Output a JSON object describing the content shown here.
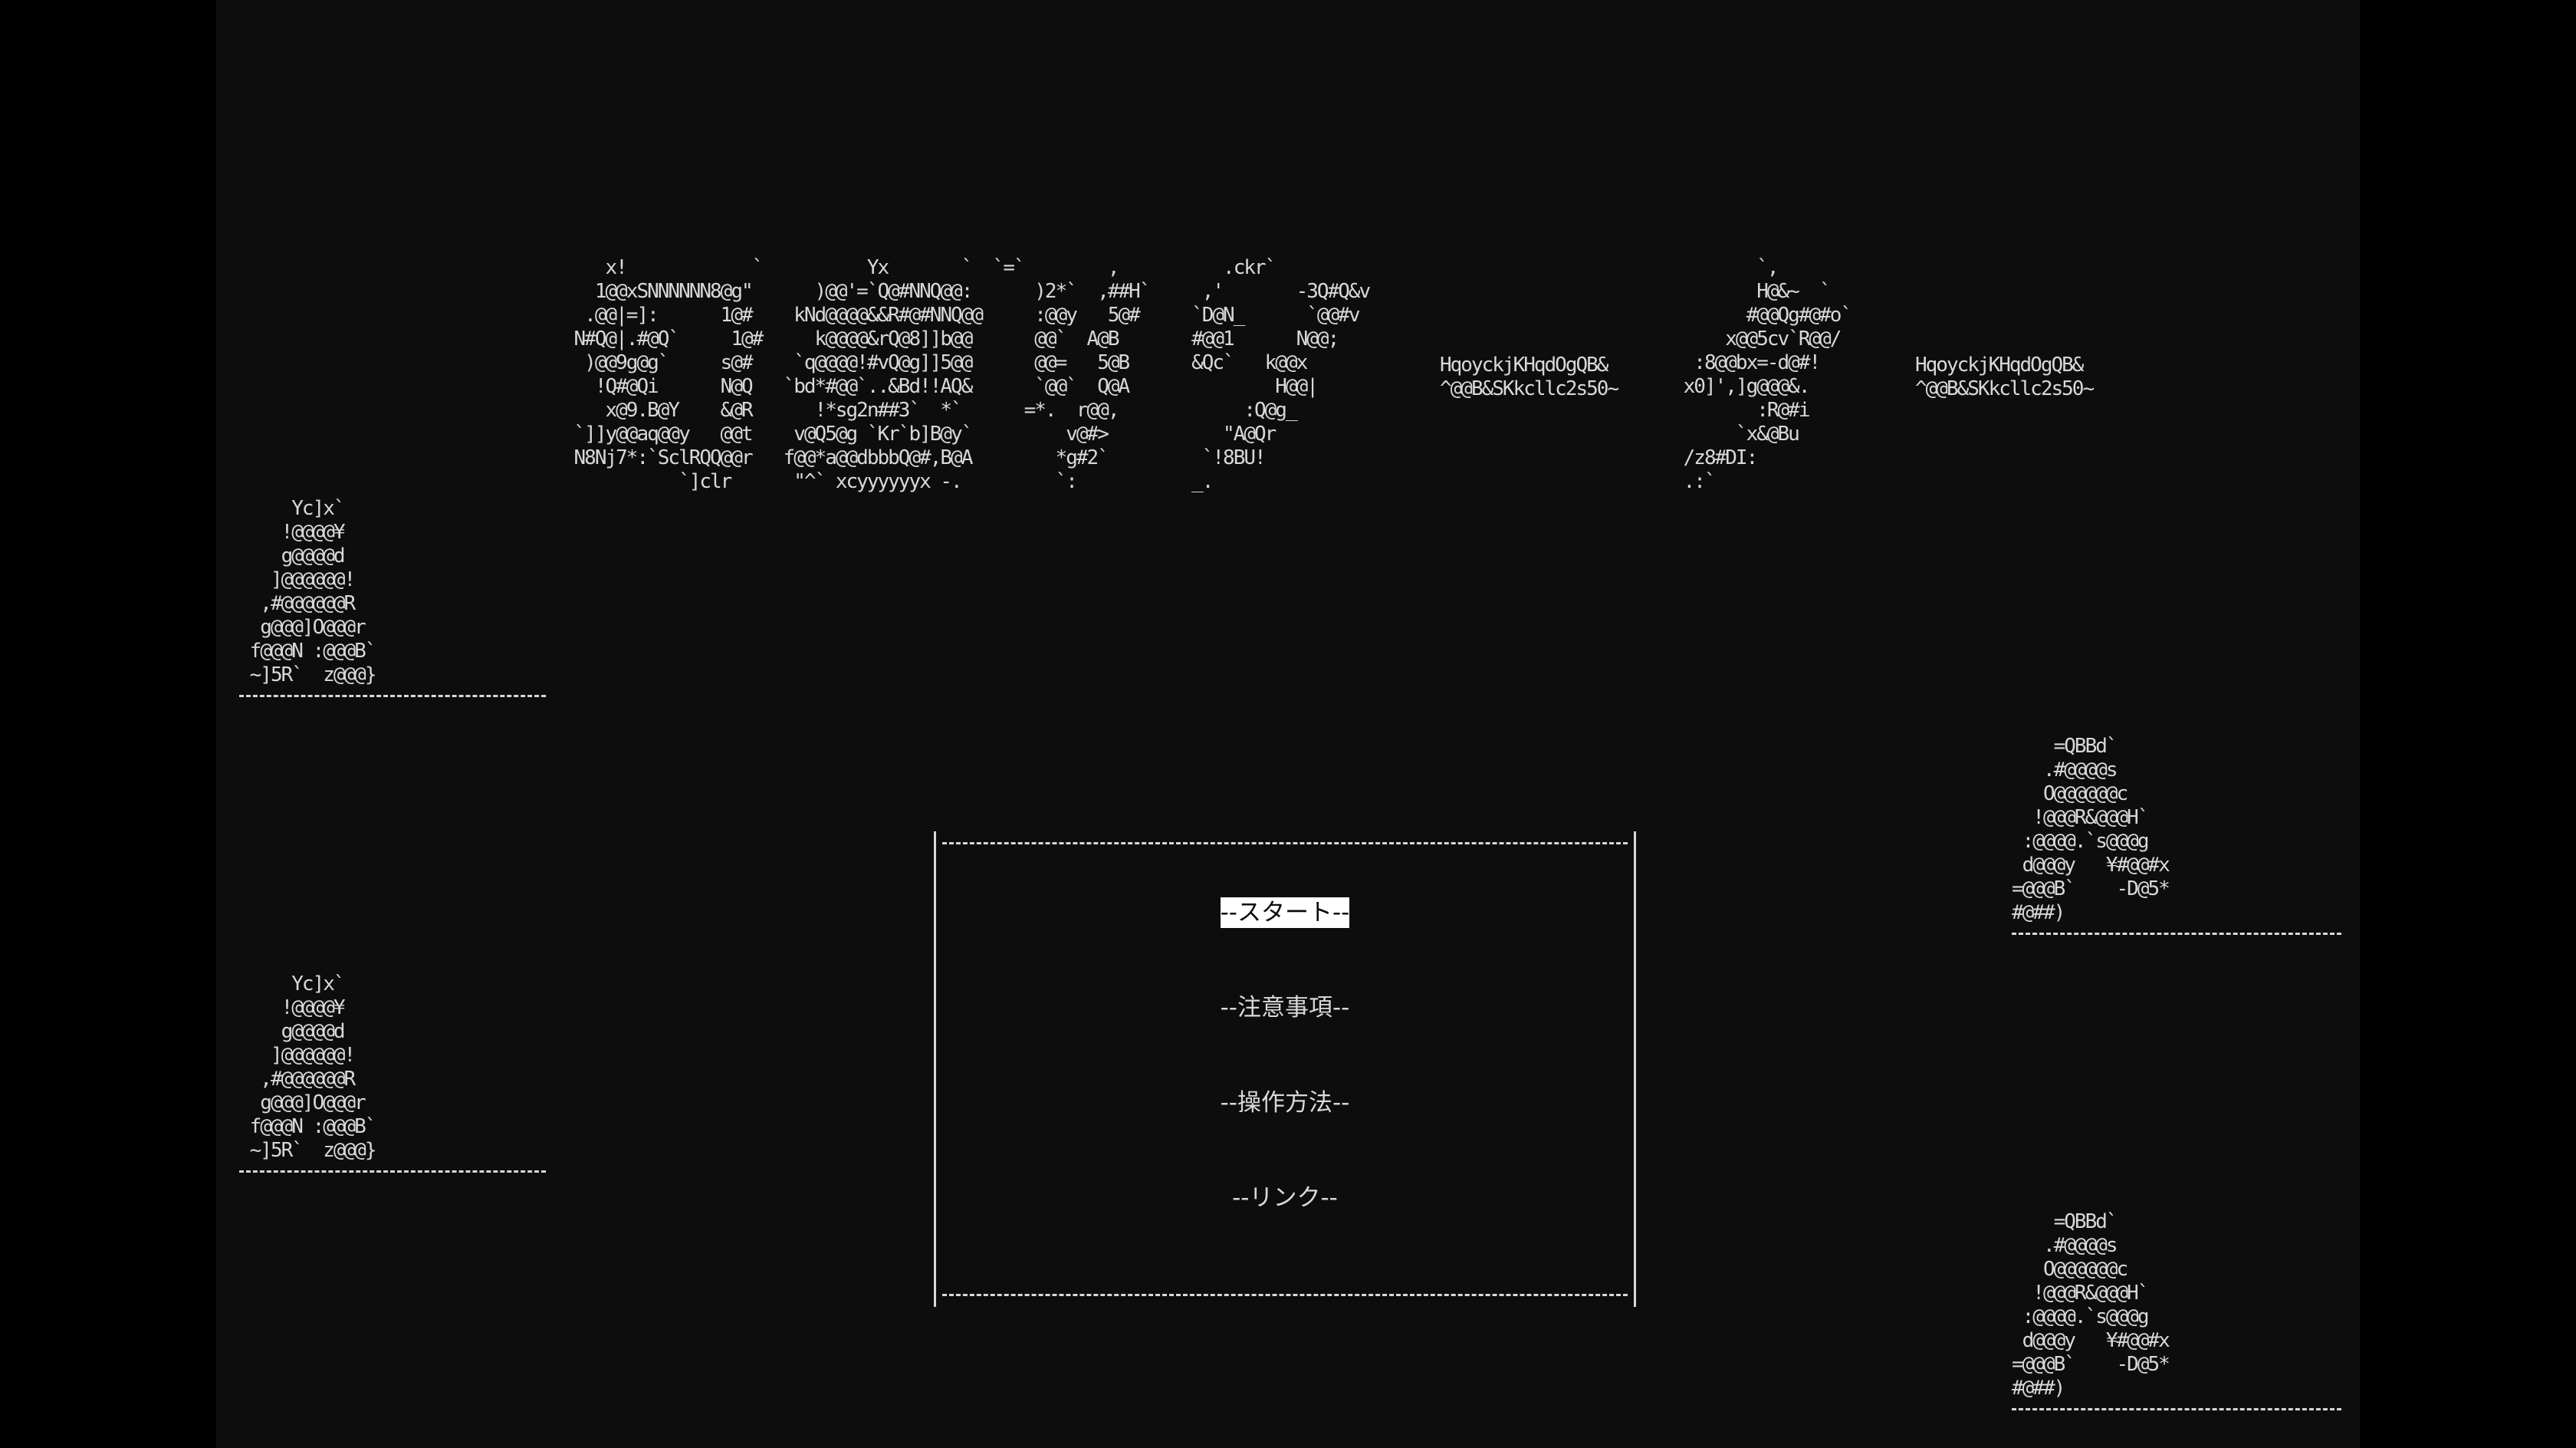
{
  "title_art": {
    "main": "             x!            `          Yx       `  `=`        ,          .ckr`\n            1@@xSNNNNNN8@g\"      )@@'=`Q@#NNQ@@:      )2*`  ,##H`     ,'       -3Q#Q&v\n           .@@|=]:      1@#    kNd@@@@&&R#@#NNQ@@     :@@y   5@#     `D@N_      `@@#v\n          N#Q@|.#@Q`     1@#     k@@@@&rQ@8]]b@@      @@`  A@B       #@@1      N@@;\n           )@@9g@g`     s@#    `q@@@@!#vQ@g]]5@@      @@=   5@B      &Qc`   k@@x\n            !Q#@Qi      N@Q   `bd*#@@`..&Bd!!AQ&      `@@`  Q@A              H@@|\n             x@9.B@Y    &@R      !*sg2n##3`  *`      =*.  r@@,            :Q@g_\n          `]]y@@aq@@y   @@t    v@Q5@g `Kr`b]B@y`         v@#>           \"A@Qr\n          N8Nj7*:`SclRQQ@@r   f@@*a@@dbbbQ@#,B@A        *g#2`         `!8BU!\n                    `]clr      \"^` xcyyyyyyx -.         `:           _.",
    "subtitle_1": "HqoyckjKHqdOgQB&\n^@@B&SKkcllc2s50~",
    "subtitle_2": "HqoyckjKHqdOgQB&\n^@@B&SKkcllc2s50~",
    "glyph_right": "        `,\n        H@&~  `\n       #@@Qg#@#o`\n     x@@5cv`R@@/\n  :8@@bx=-d@#!\n x0]',]g@@@&.\n        :R@#i\n      `x&@Bu\n /z8#DI:\n .:`"
  },
  "figures": {
    "cone": "     Yc]x`\n    !@@@@¥\n    g@@@@d\n   ]@@@@@@!\n  ,#@@@@@@R\n  g@@@]O@@@r\n f@@@N :@@@B`\n ~]5R`  z@@@}",
    "arch": "    =QBBd`\n   .#@@@@s\n   O@@@@@@c\n  !@@@R&@@@H`\n :@@@@.`s@@@g\n d@@@y   ¥#@@#x\n=@@@B`    -D@5*\n#@##)"
  },
  "menu": {
    "items": [
      {
        "label": "--スタート--",
        "selected": true
      },
      {
        "label": "--注意事項--",
        "selected": false
      },
      {
        "label": "--操作方法--",
        "selected": false
      },
      {
        "label": "--リンク--",
        "selected": false
      }
    ]
  },
  "colors": {
    "background": "#0d0d0d",
    "letterbox": "#000000",
    "foreground": "#d8d8d8",
    "highlight": "#ffffff"
  }
}
